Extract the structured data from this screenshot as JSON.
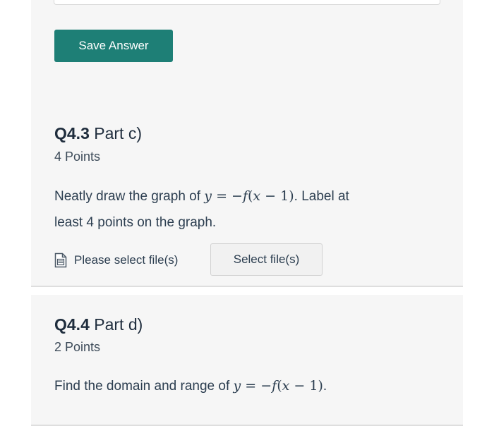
{
  "save_button": {
    "label": "Save Answer"
  },
  "q43": {
    "number": "Q4.3",
    "part": "Part c)",
    "points": "4 Points",
    "text_before": "Neatly draw the graph of ",
    "math": {
      "lhs": "y",
      "eq": " = −",
      "f": "f",
      "open": "(",
      "x": "x",
      "rest": " − 1)"
    },
    "text_after_line1": ". Label at",
    "text_line2": "least 4 points on the graph.",
    "file_label": "Please select file(s)",
    "select_button": "Select file(s)"
  },
  "q44": {
    "number": "Q4.4",
    "part": "Part d)",
    "points": "2 Points",
    "text_before": "Find the domain and range of ",
    "math": {
      "lhs": "y",
      "eq": " = −",
      "f": "f",
      "open": "(",
      "x": "x",
      "rest": " − 1)"
    },
    "text_after": "."
  },
  "icons": {
    "file": "file-document-icon"
  },
  "colors": {
    "primary": "#1e7f76",
    "panel_bg": "#f6f6f6"
  }
}
